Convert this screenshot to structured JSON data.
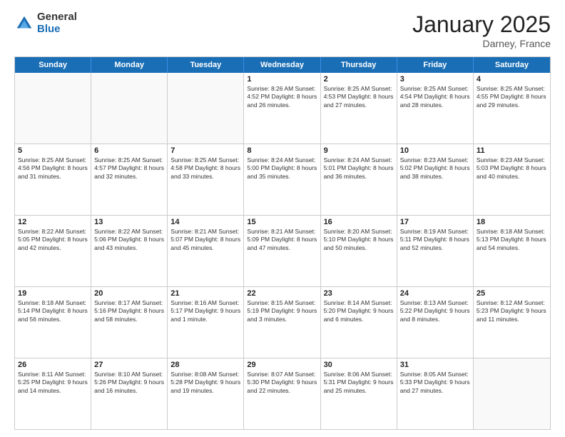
{
  "logo": {
    "general": "General",
    "blue": "Blue"
  },
  "title": "January 2025",
  "location": "Darney, France",
  "header_days": [
    "Sunday",
    "Monday",
    "Tuesday",
    "Wednesday",
    "Thursday",
    "Friday",
    "Saturday"
  ],
  "rows": [
    [
      {
        "day": "",
        "text": ""
      },
      {
        "day": "",
        "text": ""
      },
      {
        "day": "",
        "text": ""
      },
      {
        "day": "1",
        "text": "Sunrise: 8:26 AM\nSunset: 4:52 PM\nDaylight: 8 hours\nand 26 minutes."
      },
      {
        "day": "2",
        "text": "Sunrise: 8:25 AM\nSunset: 4:53 PM\nDaylight: 8 hours\nand 27 minutes."
      },
      {
        "day": "3",
        "text": "Sunrise: 8:25 AM\nSunset: 4:54 PM\nDaylight: 8 hours\nand 28 minutes."
      },
      {
        "day": "4",
        "text": "Sunrise: 8:25 AM\nSunset: 4:55 PM\nDaylight: 8 hours\nand 29 minutes."
      }
    ],
    [
      {
        "day": "5",
        "text": "Sunrise: 8:25 AM\nSunset: 4:56 PM\nDaylight: 8 hours\nand 31 minutes."
      },
      {
        "day": "6",
        "text": "Sunrise: 8:25 AM\nSunset: 4:57 PM\nDaylight: 8 hours\nand 32 minutes."
      },
      {
        "day": "7",
        "text": "Sunrise: 8:25 AM\nSunset: 4:58 PM\nDaylight: 8 hours\nand 33 minutes."
      },
      {
        "day": "8",
        "text": "Sunrise: 8:24 AM\nSunset: 5:00 PM\nDaylight: 8 hours\nand 35 minutes."
      },
      {
        "day": "9",
        "text": "Sunrise: 8:24 AM\nSunset: 5:01 PM\nDaylight: 8 hours\nand 36 minutes."
      },
      {
        "day": "10",
        "text": "Sunrise: 8:23 AM\nSunset: 5:02 PM\nDaylight: 8 hours\nand 38 minutes."
      },
      {
        "day": "11",
        "text": "Sunrise: 8:23 AM\nSunset: 5:03 PM\nDaylight: 8 hours\nand 40 minutes."
      }
    ],
    [
      {
        "day": "12",
        "text": "Sunrise: 8:22 AM\nSunset: 5:05 PM\nDaylight: 8 hours\nand 42 minutes."
      },
      {
        "day": "13",
        "text": "Sunrise: 8:22 AM\nSunset: 5:06 PM\nDaylight: 8 hours\nand 43 minutes."
      },
      {
        "day": "14",
        "text": "Sunrise: 8:21 AM\nSunset: 5:07 PM\nDaylight: 8 hours\nand 45 minutes."
      },
      {
        "day": "15",
        "text": "Sunrise: 8:21 AM\nSunset: 5:09 PM\nDaylight: 8 hours\nand 47 minutes."
      },
      {
        "day": "16",
        "text": "Sunrise: 8:20 AM\nSunset: 5:10 PM\nDaylight: 8 hours\nand 50 minutes."
      },
      {
        "day": "17",
        "text": "Sunrise: 8:19 AM\nSunset: 5:11 PM\nDaylight: 8 hours\nand 52 minutes."
      },
      {
        "day": "18",
        "text": "Sunrise: 8:18 AM\nSunset: 5:13 PM\nDaylight: 8 hours\nand 54 minutes."
      }
    ],
    [
      {
        "day": "19",
        "text": "Sunrise: 8:18 AM\nSunset: 5:14 PM\nDaylight: 8 hours\nand 56 minutes."
      },
      {
        "day": "20",
        "text": "Sunrise: 8:17 AM\nSunset: 5:16 PM\nDaylight: 8 hours\nand 58 minutes."
      },
      {
        "day": "21",
        "text": "Sunrise: 8:16 AM\nSunset: 5:17 PM\nDaylight: 9 hours\nand 1 minute."
      },
      {
        "day": "22",
        "text": "Sunrise: 8:15 AM\nSunset: 5:19 PM\nDaylight: 9 hours\nand 3 minutes."
      },
      {
        "day": "23",
        "text": "Sunrise: 8:14 AM\nSunset: 5:20 PM\nDaylight: 9 hours\nand 6 minutes."
      },
      {
        "day": "24",
        "text": "Sunrise: 8:13 AM\nSunset: 5:22 PM\nDaylight: 9 hours\nand 8 minutes."
      },
      {
        "day": "25",
        "text": "Sunrise: 8:12 AM\nSunset: 5:23 PM\nDaylight: 9 hours\nand 11 minutes."
      }
    ],
    [
      {
        "day": "26",
        "text": "Sunrise: 8:11 AM\nSunset: 5:25 PM\nDaylight: 9 hours\nand 14 minutes."
      },
      {
        "day": "27",
        "text": "Sunrise: 8:10 AM\nSunset: 5:26 PM\nDaylight: 9 hours\nand 16 minutes."
      },
      {
        "day": "28",
        "text": "Sunrise: 8:08 AM\nSunset: 5:28 PM\nDaylight: 9 hours\nand 19 minutes."
      },
      {
        "day": "29",
        "text": "Sunrise: 8:07 AM\nSunset: 5:30 PM\nDaylight: 9 hours\nand 22 minutes."
      },
      {
        "day": "30",
        "text": "Sunrise: 8:06 AM\nSunset: 5:31 PM\nDaylight: 9 hours\nand 25 minutes."
      },
      {
        "day": "31",
        "text": "Sunrise: 8:05 AM\nSunset: 5:33 PM\nDaylight: 9 hours\nand 27 minutes."
      },
      {
        "day": "",
        "text": ""
      }
    ]
  ]
}
